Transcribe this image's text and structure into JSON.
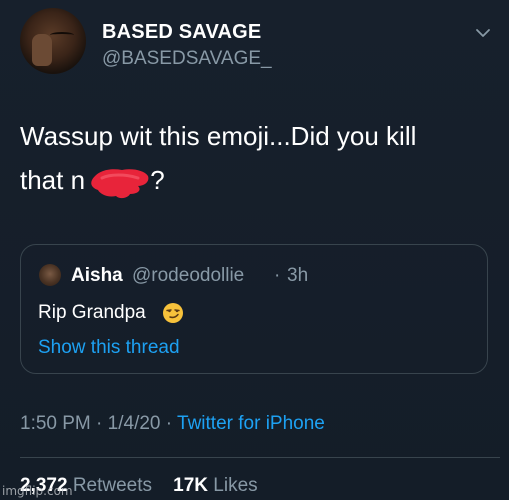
{
  "header": {
    "display_name": "BASED SAVAGE",
    "handle": "@BASEDSAVAGE_",
    "menu_icon": "chevron-down-icon"
  },
  "tweet": {
    "text": "Wassup wit this emoji...Did you kill\nthat n",
    "text_tail": " ?"
  },
  "quote": {
    "name": "Aisha",
    "handle": "@rodeodollie",
    "separator": "·",
    "time": "3h",
    "text": "Rip Grandpa",
    "emoji": "smirking-face-emoji",
    "link": "Show this thread"
  },
  "meta": {
    "time": "1:50 PM",
    "date": "1/4/20",
    "separator": "·",
    "source": "Twitter for iPhone"
  },
  "stats": {
    "retweets_count": "2,372",
    "retweets_label": "Retweets",
    "likes_count": "17K",
    "likes_label": "Likes"
  },
  "watermark": "imgflip.com",
  "colors": {
    "background": "#15202b",
    "secondary_text": "#8899a6",
    "link": "#1da1f2",
    "border": "#38444d",
    "redaction": "#e8243a"
  }
}
